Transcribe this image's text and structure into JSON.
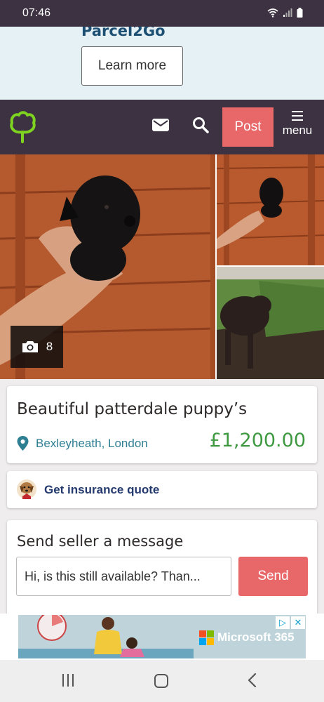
{
  "status": {
    "time": "07:46"
  },
  "ad_top": {
    "brand": "Parcel2Go",
    "cta_label": "Learn more"
  },
  "nav": {
    "post_label": "Post",
    "menu_label": "menu"
  },
  "gallery": {
    "photo_count": "8"
  },
  "listing": {
    "title": "Beautiful patterdale puppy’s",
    "location": "Bexleyheath, London",
    "price": "£1,200.00"
  },
  "insurance": {
    "label": "Get insurance quote"
  },
  "message": {
    "title": "Send seller a message",
    "input_value": "Hi, is this still available? Than...",
    "send_label": "Send"
  },
  "ad_bottom": {
    "brand_label": "Microsoft 365"
  },
  "colors": {
    "accent": "#e8686a",
    "nav_bg": "#3c3241",
    "price": "#3e9940",
    "location": "#2f7f93"
  }
}
